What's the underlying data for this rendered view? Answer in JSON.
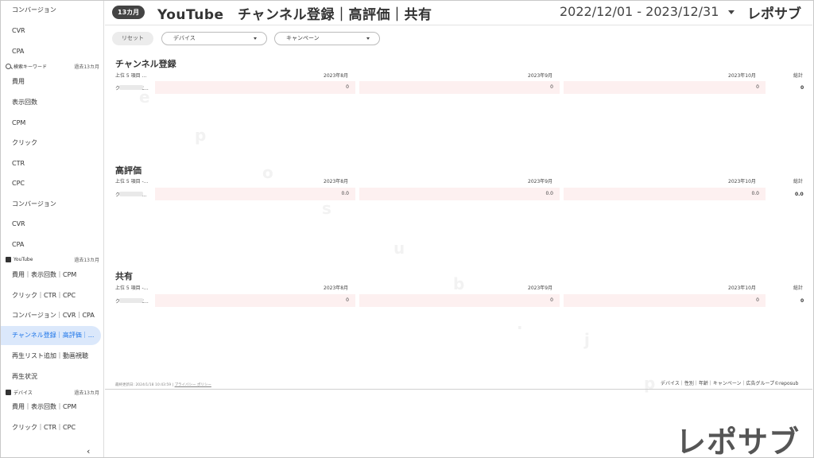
{
  "sidebar": {
    "items_top": [
      {
        "label": "コンバージョン"
      },
      {
        "label": "CVR"
      },
      {
        "label": "CPA"
      }
    ],
    "search_section": {
      "title": "検索キーワード",
      "period": "過去13カ月"
    },
    "search_items": [
      {
        "label": "費用"
      },
      {
        "label": "表示回数"
      },
      {
        "label": "CPM"
      },
      {
        "label": "クリック"
      },
      {
        "label": "CTR"
      },
      {
        "label": "CPC"
      },
      {
        "label": "コンバージョン"
      },
      {
        "label": "CVR"
      },
      {
        "label": "CPA"
      }
    ],
    "youtube_section": {
      "title": "YouTube",
      "period": "過去13カ月"
    },
    "youtube_items": [
      {
        "label": "費用｜表示回数｜CPM"
      },
      {
        "label": "クリック｜CTR｜CPC"
      },
      {
        "label": "コンバージョン｜CVR｜CPA"
      },
      {
        "label": "チャンネル登録｜高評価｜..."
      },
      {
        "label": "再生リスト追加｜動画視聴"
      },
      {
        "label": "再生状況"
      }
    ],
    "device_section": {
      "title": "デバイス",
      "period": "過去13カ月"
    },
    "device_items": [
      {
        "label": "費用｜表示回数｜CPM"
      },
      {
        "label": "クリック｜CTR｜CPC"
      }
    ],
    "collapse_label": "‹"
  },
  "header": {
    "badge": "13カ月",
    "title": "YouTube　チャンネル登録｜高評価｜共有",
    "date_range": "2022/12/01 - 2023/12/31",
    "brand": "レポサブ"
  },
  "filters": {
    "reset_label": "リセット",
    "device_label": "デバイス",
    "campaign_label": "キャンペーン"
  },
  "sections": [
    {
      "title": "チャンネル登録",
      "row_header": "上位 5 項目 ...",
      "columns": [
        "2023年8月",
        "2023年9月",
        "2023年10月"
      ],
      "total_header": "総計",
      "row_label": "ク",
      "row_label_tail": "C...",
      "values": [
        "0",
        "0",
        "0"
      ],
      "total": "0"
    },
    {
      "title": "高評価",
      "row_header": "上位 5 項目 -...",
      "columns": [
        "2023年8月",
        "2023年9月",
        "2023年10月"
      ],
      "total_header": "総計",
      "row_label": "ク",
      "row_label_tail": ":...",
      "values": [
        "0.0",
        "0.0",
        "0.0"
      ],
      "total": "0.0"
    },
    {
      "title": "共有",
      "row_header": "上位 5 項目 -...",
      "columns": [
        "2023年8月",
        "2023年9月",
        "2023年10月"
      ],
      "total_header": "総計",
      "row_label": "ク",
      "row_label_tail": "C...",
      "values": [
        "0",
        "0",
        "0"
      ],
      "total": "0"
    }
  ],
  "footer": {
    "updated": "最終更新日: 2024/1/18 10:43:59",
    "privacy": "プライバシー ポリシー",
    "links": "デバイス｜性別｜年齢｜キャンペーン｜広告グループ©reposub"
  },
  "watermark": {
    "logo": "レポサブ",
    "letters": [
      "r",
      "e",
      "p",
      "o",
      "s",
      "u",
      "b",
      ".",
      "j",
      "p"
    ]
  }
}
